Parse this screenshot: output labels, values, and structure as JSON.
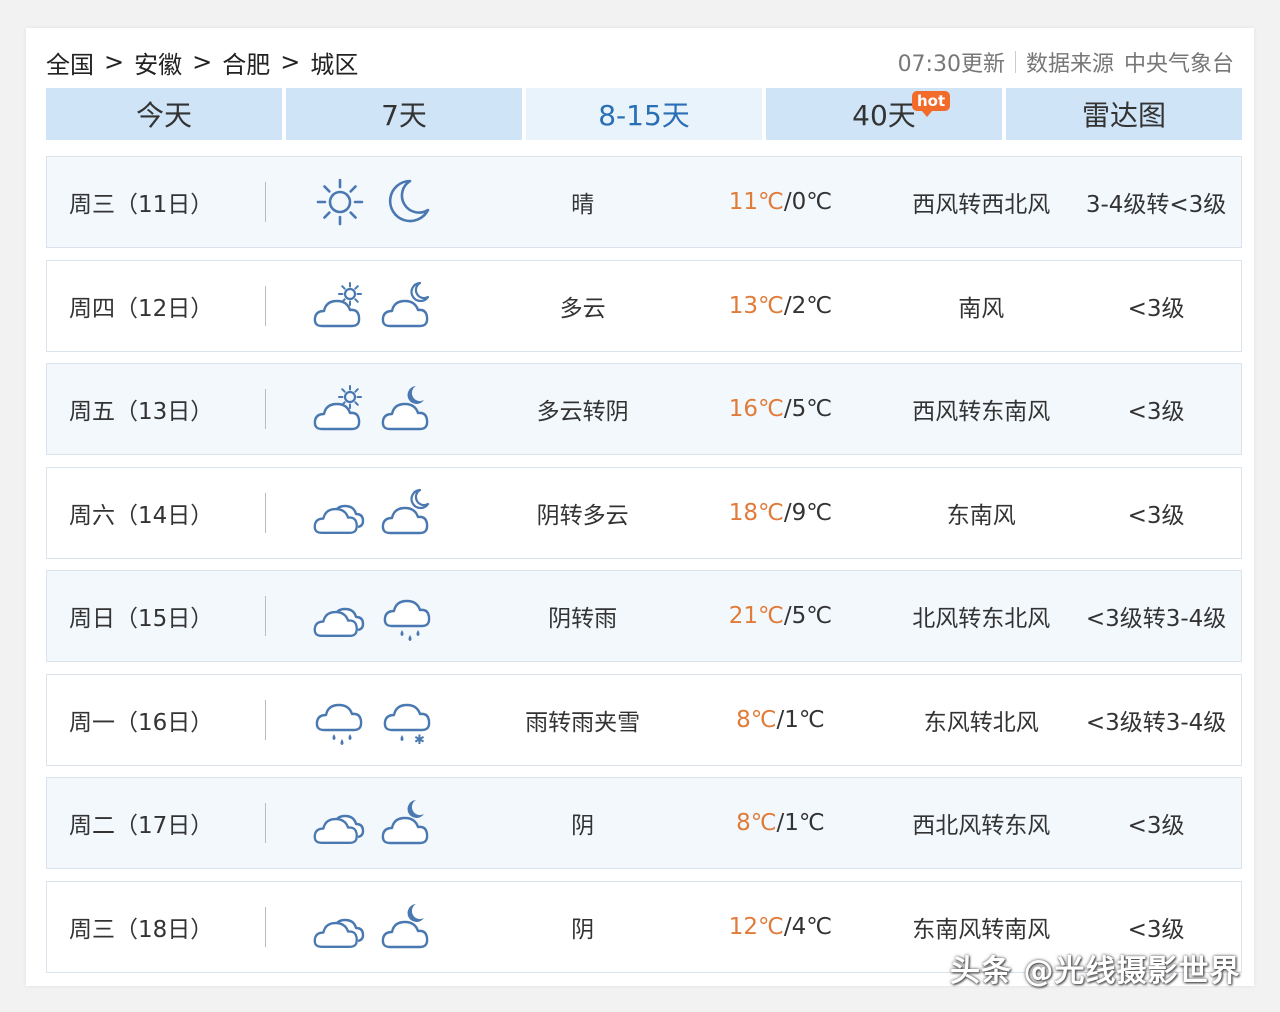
{
  "breadcrumb": {
    "items": [
      "全国",
      "安徽",
      "合肥",
      "城区"
    ],
    "separator": ">"
  },
  "meta": {
    "update_time": "07:30更新",
    "source_label": "数据来源",
    "source": "中央气象台"
  },
  "tabs": [
    {
      "label": "今天"
    },
    {
      "label": "7天"
    },
    {
      "label": "8-15天",
      "active": true
    },
    {
      "label": "40天",
      "badge": "hot"
    },
    {
      "label": "雷达图"
    }
  ],
  "colors": {
    "tab_bg": "#cfe4f7",
    "tab_active_text": "#2a6fb6",
    "high_temp": "#e07b39",
    "icon_stroke": "#4a78b0",
    "hot_badge": "#f26b2b"
  },
  "forecast": [
    {
      "day": "周三（11日）",
      "day_icon": "sun-icon",
      "night_icon": "moon-icon",
      "weather": "晴",
      "high": "11℃",
      "low": "/0℃",
      "wind": "西风转西北风",
      "level": "3-4级转<3级"
    },
    {
      "day": "周四（12日）",
      "day_icon": "partly-cloudy-day-icon",
      "night_icon": "partly-cloudy-night-icon",
      "weather": "多云",
      "high": "13℃",
      "low": "/2℃",
      "wind": "南风",
      "level": "<3级"
    },
    {
      "day": "周五（13日）",
      "day_icon": "partly-cloudy-day-icon",
      "night_icon": "cloudy-night-icon",
      "weather": "多云转阴",
      "high": "16℃",
      "low": "/5℃",
      "wind": "西风转东南风",
      "level": "<3级"
    },
    {
      "day": "周六（14日）",
      "day_icon": "overcast-icon",
      "night_icon": "partly-cloudy-night-icon",
      "weather": "阴转多云",
      "high": "18℃",
      "low": "/9℃",
      "wind": "东南风",
      "level": "<3级"
    },
    {
      "day": "周日（15日）",
      "day_icon": "overcast-icon",
      "night_icon": "rain-icon",
      "weather": "阴转雨",
      "high": "21℃",
      "low": "/5℃",
      "wind": "北风转东北风",
      "level": "<3级转3-4级"
    },
    {
      "day": "周一（16日）",
      "day_icon": "rain-icon",
      "night_icon": "sleet-icon",
      "weather": "雨转雨夹雪",
      "high": "8℃",
      "low": "/1℃",
      "wind": "东风转北风",
      "level": "<3级转3-4级"
    },
    {
      "day": "周二（17日）",
      "day_icon": "overcast-icon",
      "night_icon": "cloudy-night-icon",
      "weather": "阴",
      "high": "8℃",
      "low": "/1℃",
      "wind": "西北风转东风",
      "level": "<3级"
    },
    {
      "day": "周三（18日）",
      "day_icon": "overcast-icon",
      "night_icon": "cloudy-night-icon",
      "weather": "阴",
      "high": "12℃",
      "low": "/4℃",
      "wind": "东南风转南风",
      "level": "<3级"
    }
  ],
  "watermark": "头条 @光线摄影世界"
}
